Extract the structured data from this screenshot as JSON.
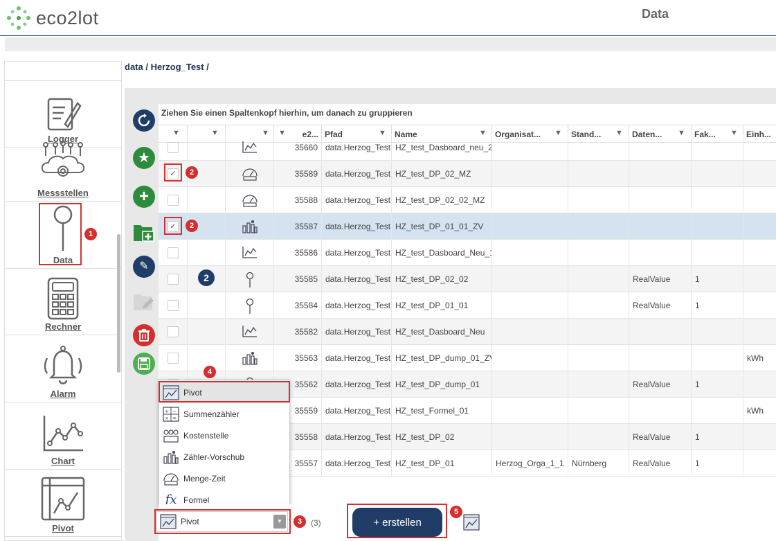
{
  "app": {
    "logo_text": "eco2lot",
    "page_title": "Data"
  },
  "breadcrumb": "data / Herzog_Test /",
  "sidebar": {
    "items": [
      {
        "label": "Logger",
        "icon": "logger-icon"
      },
      {
        "label": "Messstellen",
        "icon": "messstellen-icon"
      },
      {
        "label": "Data",
        "icon": "pin-icon"
      },
      {
        "label": "Rechner",
        "icon": "calculator-icon"
      },
      {
        "label": "Alarm",
        "icon": "bell-icon"
      },
      {
        "label": "Chart",
        "icon": "chart-icon"
      },
      {
        "label": "Pivot",
        "icon": "pivot-icon"
      }
    ]
  },
  "toolbar": [
    {
      "icon": "refresh-icon",
      "color": "#1f3d66"
    },
    {
      "icon": "star-icon",
      "color": "#2e8b3e"
    },
    {
      "icon": "add-icon",
      "color": "#2e8b3e"
    },
    {
      "icon": "add-folder-icon",
      "color": "#2e8b3e"
    },
    {
      "icon": "edit-icon",
      "color": "#1f3d66"
    },
    {
      "icon": "edit-folder-icon",
      "color": "#cccccc"
    },
    {
      "icon": "delete-icon",
      "color": "#d32f2f"
    },
    {
      "icon": "save-icon",
      "color": "#4caf50"
    }
  ],
  "grid": {
    "group_hint": "Ziehen Sie einen Spaltenkopf hierhin, um danach zu gruppieren",
    "columns": [
      "",
      "",
      "",
      "e2...",
      "Pfad",
      "Name",
      "Organisat...",
      "Stand...",
      "Daten...",
      "Fak...",
      "Einh..."
    ],
    "rows": [
      {
        "id": "35660",
        "pfad": "data.Herzog_Test",
        "name": "HZ_test_Dasboard_neu_2",
        "org": "",
        "stand": "",
        "daten": "",
        "fak": "",
        "einh": "",
        "icon": "chart-small-icon",
        "checked": false
      },
      {
        "id": "35589",
        "pfad": "data.Herzog_Test",
        "name": "HZ_test_DP_02_MZ",
        "org": "",
        "stand": "",
        "daten": "",
        "fak": "",
        "einh": "",
        "icon": "menge-zeit-icon",
        "checked": true
      },
      {
        "id": "35588",
        "pfad": "data.Herzog_Test",
        "name": "HZ_test_DP_02_02_MZ",
        "org": "",
        "stand": "",
        "daten": "",
        "fak": "",
        "einh": "",
        "icon": "menge-zeit-icon",
        "checked": false
      },
      {
        "id": "35587",
        "pfad": "data.Herzog_Test",
        "name": "HZ_test_DP_01_01_ZV",
        "org": "",
        "stand": "",
        "daten": "",
        "fak": "",
        "einh": "",
        "icon": "zaehler-vorschub-icon",
        "checked": true
      },
      {
        "id": "35586",
        "pfad": "data.Herzog_Test",
        "name": "HZ_test_Dasboard_Neu_1",
        "org": "",
        "stand": "",
        "daten": "",
        "fak": "",
        "einh": "",
        "icon": "chart-small-icon",
        "checked": false
      },
      {
        "id": "35585",
        "pfad": "data.Herzog_Test",
        "name": "HZ_test_DP_02_02",
        "org": "",
        "stand": "",
        "daten": "RealValue",
        "fak": "1",
        "einh": "",
        "icon": "pin-small-icon",
        "checked": false
      },
      {
        "id": "35584",
        "pfad": "data.Herzog_Test",
        "name": "HZ_test_DP_01_01",
        "org": "",
        "stand": "",
        "daten": "RealValue",
        "fak": "1",
        "einh": "",
        "icon": "pin-small-icon",
        "checked": false
      },
      {
        "id": "35582",
        "pfad": "data.Herzog_Test",
        "name": "HZ_test_Dasboard_Neu",
        "org": "",
        "stand": "",
        "daten": "",
        "fak": "",
        "einh": "",
        "icon": "chart-small-icon",
        "checked": false
      },
      {
        "id": "35563",
        "pfad": "data.Herzog_Test",
        "name": "HZ_test_DP_dump_01_ZV",
        "org": "",
        "stand": "",
        "daten": "",
        "fak": "",
        "einh": "kWh",
        "icon": "zaehler-vorschub-icon",
        "checked": false
      },
      {
        "id": "35562",
        "pfad": "data.Herzog_Test",
        "name": "HZ_test_DP_dump_01",
        "org": "",
        "stand": "",
        "daten": "RealValue",
        "fak": "1",
        "einh": "",
        "icon": "pin-small-icon",
        "checked": false
      },
      {
        "id": "35559",
        "pfad": "data.Herzog_Test",
        "name": "HZ_test_Formel_01",
        "org": "",
        "stand": "",
        "daten": "",
        "fak": "",
        "einh": "kWh",
        "icon": "formel-icon",
        "checked": false
      },
      {
        "id": "35558",
        "pfad": "data.Herzog_Test",
        "name": "HZ_test_DP_02",
        "org": "",
        "stand": "",
        "daten": "RealValue",
        "fak": "1",
        "einh": "",
        "icon": "pin-small-icon",
        "checked": false
      },
      {
        "id": "35557",
        "pfad": "data.Herzog_Test",
        "name": "HZ_test_DP_01",
        "org": "Herzog_Orga_1_1",
        "stand": "Nürnberg",
        "daten": "RealValue",
        "fak": "1",
        "einh": "",
        "icon": "pin-small-icon",
        "checked": false
      }
    ]
  },
  "dropdown": {
    "options": [
      {
        "label": "Pivot",
        "icon": "pivot-icon"
      },
      {
        "label": "Summenzähler",
        "icon": "summenzaehler-icon"
      },
      {
        "label": "Kostenstelle",
        "icon": "kostenstelle-icon"
      },
      {
        "label": "Zähler-Vorschub",
        "icon": "zaehler-vorschub-icon"
      },
      {
        "label": "Menge-Zeit",
        "icon": "menge-zeit-icon"
      },
      {
        "label": "Formel",
        "icon": "formel-icon"
      }
    ],
    "selected": "Pivot"
  },
  "bottom": {
    "count": "(3)",
    "create_label": "+ erstellen"
  },
  "annotations": [
    "1",
    "2",
    "2",
    "2",
    "3",
    "4",
    "5"
  ],
  "selection_count_badge": "2"
}
